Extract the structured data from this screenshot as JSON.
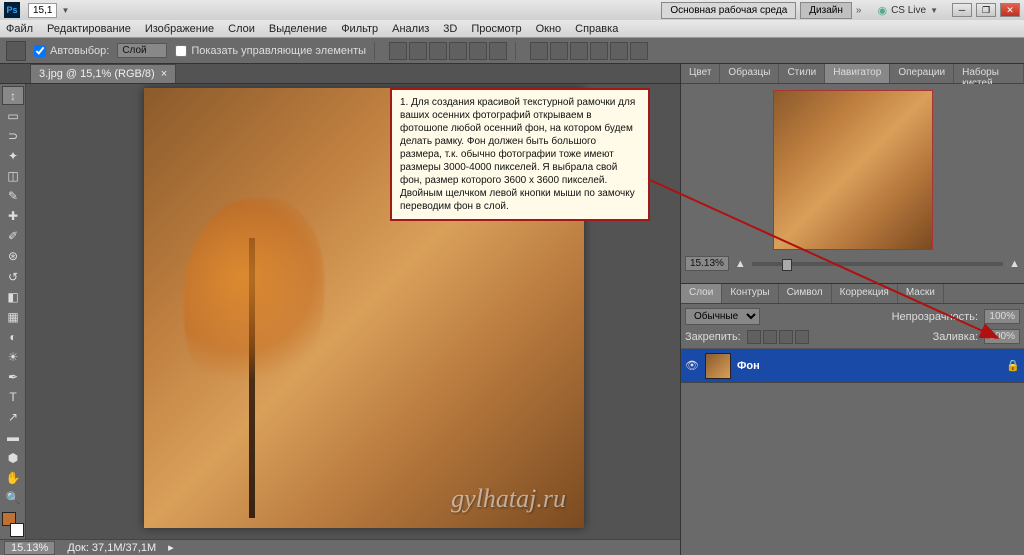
{
  "title": {
    "zoom": "15,1",
    "workspace_main": "Основная рабочая среда",
    "workspace_design": "Дизайн",
    "cslive": "CS Live"
  },
  "menu": [
    "Файл",
    "Редактирование",
    "Изображение",
    "Слои",
    "Выделение",
    "Фильтр",
    "Анализ",
    "3D",
    "Просмотр",
    "Окно",
    "Справка"
  ],
  "options": {
    "autoselect": "Автовыбор:",
    "autoselect_val": "Слой",
    "show_controls": "Показать управляющие элементы"
  },
  "doc_tab": "3.jpg @ 15,1% (RGB/8)",
  "annotation": "1. Для создания красивой текстурной рамочки для ваших осенних фотографий открываем в фотошопе любой осенний фон, на котором будем делать рамку. Фон должен быть большого размера, т.к. обычно фотографии тоже имеют размеры 3000-4000 пикселей. Я выбрала свой фон, размер которого 3600 х 3600 пикселей. Двойным щелчком левой кнопки мыши по замочку переводим фон в слой.",
  "watermark": "gylhataj.ru",
  "status": {
    "zoom": "15.13%",
    "doc": "Док: 37,1M/37,1M"
  },
  "panels_top": [
    "Цвет",
    "Образцы",
    "Стили",
    "Навигатор",
    "Операции",
    "Наборы кистей"
  ],
  "panels_top_active": 3,
  "nav_zoom": "15.13%",
  "panels_mid": [
    "Слои",
    "Контуры",
    "Символ",
    "Коррекция",
    "Маски"
  ],
  "panels_mid_active": 0,
  "layers": {
    "blend": "Обычные",
    "opacity_label": "Непрозрачность:",
    "opacity": "100%",
    "lock_label": "Закрепить:",
    "fill_label": "Заливка:",
    "fill": "100%",
    "layer_name": "Фон"
  }
}
